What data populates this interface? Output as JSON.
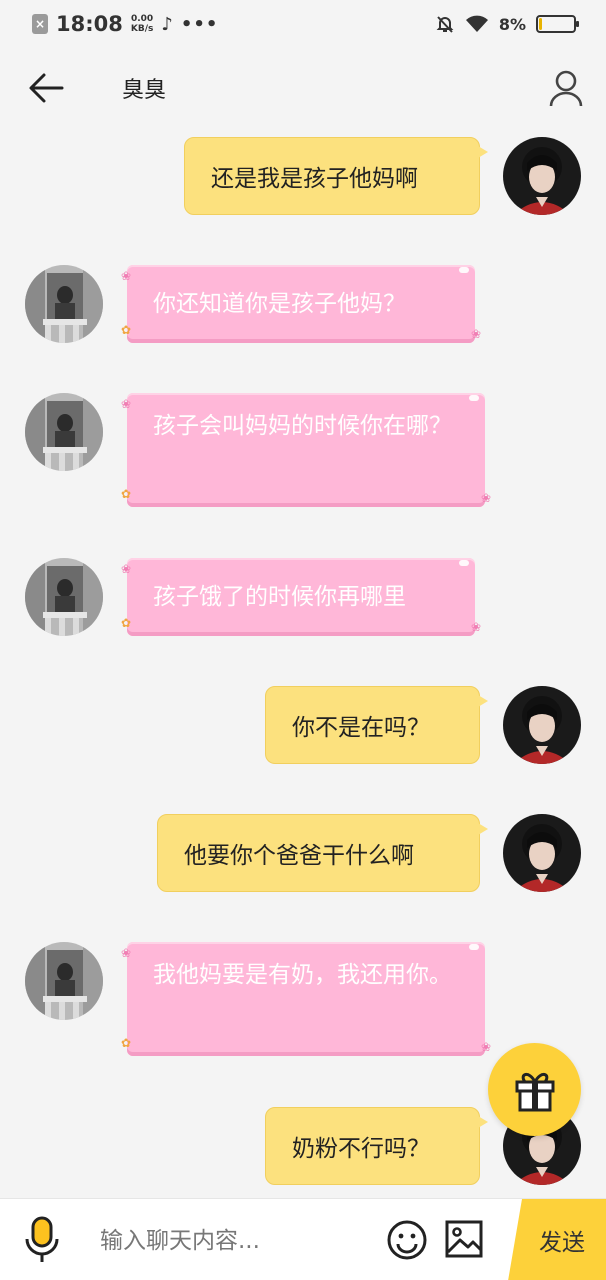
{
  "status_bar": {
    "time": "18:08",
    "net_speed_value": "0.00",
    "net_speed_unit": "KB/s",
    "more": "•••",
    "battery_percent": "8%",
    "battery_level": 0.08,
    "icons": [
      "notification-x-icon",
      "tiktok-icon",
      "mute-bell-icon",
      "wifi-icon",
      "battery-icon"
    ]
  },
  "header": {
    "title": "臭臭",
    "back_icon": "arrow-left-icon",
    "profile_icon": "person-icon"
  },
  "messages": [
    {
      "side": "right",
      "style": "yellow",
      "text": "还是我是孩子他妈啊"
    },
    {
      "side": "left",
      "style": "pink",
      "text": "你还知道你是孩子他妈？"
    },
    {
      "side": "left",
      "style": "pink",
      "text": "孩子会叫妈妈的时候你在哪？"
    },
    {
      "side": "left",
      "style": "pink",
      "text": "孩子饿了的时候你再哪里"
    },
    {
      "side": "right",
      "style": "yellow",
      "text": "你不是在吗？"
    },
    {
      "side": "right",
      "style": "yellow",
      "text": "他要你个爸爸干什么啊"
    },
    {
      "side": "left",
      "style": "pink",
      "text": "我他妈要是有奶，我还用你。"
    },
    {
      "side": "right",
      "style": "yellow",
      "text": "奶粉不行吗？"
    }
  ],
  "gift_icon": "gift-icon",
  "input_bar": {
    "placeholder": "输入聊天内容...",
    "send_label": "发送",
    "icons": [
      "microphone-icon",
      "emoji-icon",
      "image-icon"
    ]
  },
  "colors": {
    "yellow_bubble": "#fce17e",
    "pink_bubble": "#ffb7d8",
    "accent": "#fdd13a",
    "background": "#f4f4f4"
  }
}
